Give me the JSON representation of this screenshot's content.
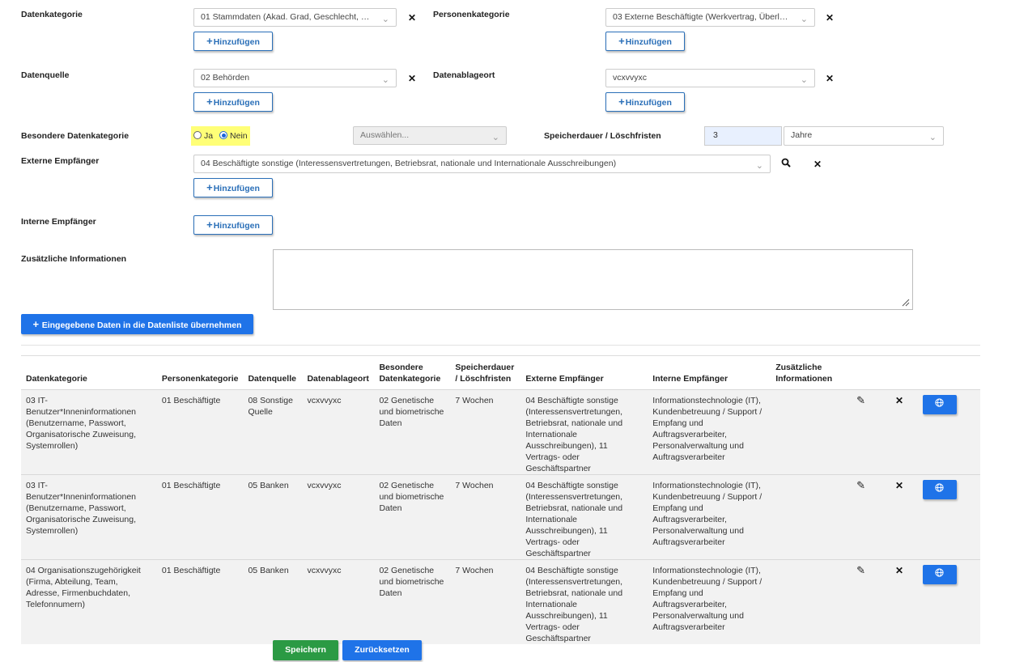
{
  "form": {
    "datenkategorie": {
      "label": "Datenkategorie",
      "value": "01 Stammdaten (Akad. Grad, Geschlecht, Vor..."
    },
    "personenkategorie": {
      "label": "Personenkategorie",
      "value": "03 Externe Beschäftigte (Werkvertrag, Überlass..."
    },
    "datenquelle": {
      "label": "Datenquelle",
      "value": "02 Behörden"
    },
    "datenablageort": {
      "label": "Datenablageort",
      "value": "vcxvvyxc"
    },
    "besondere": {
      "label": "Besondere Datenkategorie",
      "ja": "Ja",
      "nein": "Nein",
      "select_placeholder": "Auswählen..."
    },
    "speicherdauer": {
      "label": "Speicherdauer / Löschfristen",
      "value": "3",
      "unit": "Jahre"
    },
    "externe": {
      "label": "Externe Empfänger",
      "value": "04 Beschäftigte sonstige (Interessensvertretungen, Betriebsrat, nationale und Internationale Ausschreibungen)"
    },
    "interne": {
      "label": "Interne Empfänger"
    },
    "zusatz": {
      "label": "Zusätzliche Informationen"
    },
    "add_label": "Hinzufügen",
    "remove_glyph": "✕",
    "submit_label": "Eingegebene Daten in die Datenliste übernehmen"
  },
  "table": {
    "headers": {
      "c1": "Datenkategorie",
      "c2": "Personenkategorie",
      "c3": "Datenquelle",
      "c4": "Datenablageort",
      "c5": "Besondere Datenkategorie",
      "c6": "Speicherdauer / Löschfristen",
      "c7": "Externe Empfänger",
      "c8": "Interne Empfänger",
      "c9": "Zusätzliche Informationen"
    },
    "rows": [
      {
        "datenkategorie": "03 IT-Benutzer*Inneninformationen (Benutzername, Passwort, Organisatorische Zuweisung, Systemrollen)",
        "personenkategorie": "01 Beschäftigte",
        "datenquelle": "08 Sonstige Quelle",
        "datenablageort": "vcxvvyxc",
        "besondere": "02 Genetische und biometrische Daten",
        "speicherdauer": "7 Wochen",
        "externe": "04 Beschäftigte sonstige (Interessensvertretungen, Betriebsrat, nationale und Internationale Ausschreibungen), 11 Vertrags- oder Geschäftspartner",
        "interne": "Informationstechnologie (IT), Kundenbetreuung / Support / Empfang und Auftragsverarbeiter, Personalverwaltung und Auftragsverarbeiter",
        "zusatz": ""
      },
      {
        "datenkategorie": "03 IT-Benutzer*Inneninformationen (Benutzername, Passwort, Organisatorische Zuweisung, Systemrollen)",
        "personenkategorie": "01 Beschäftigte",
        "datenquelle": "05 Banken",
        "datenablageort": "vcxvvyxc",
        "besondere": "02 Genetische und biometrische Daten",
        "speicherdauer": "7 Wochen",
        "externe": "04 Beschäftigte sonstige (Interessensvertretungen, Betriebsrat, nationale und Internationale Ausschreibungen), 11 Vertrags- oder Geschäftspartner",
        "interne": "Informationstechnologie (IT), Kundenbetreuung / Support / Empfang und Auftragsverarbeiter, Personalverwaltung und Auftragsverarbeiter",
        "zusatz": ""
      },
      {
        "datenkategorie": "04 Organisationszugehörigkeit (Firma, Abteilung, Team, Adresse, Firmenbuchdaten, Telefonnumern)",
        "personenkategorie": "01 Beschäftigte",
        "datenquelle": "05 Banken",
        "datenablageort": "vcxvvyxc",
        "besondere": "02 Genetische und biometrische Daten",
        "speicherdauer": "7 Wochen",
        "externe": "04 Beschäftigte sonstige (Interessensvertretungen, Betriebsrat, nationale und Internationale Ausschreibungen), 11 Vertrags- oder Geschäftspartner",
        "interne": "Informationstechnologie (IT), Kundenbetreuung / Support / Empfang und Auftragsverarbeiter, Personalverwaltung und Auftragsverarbeiter",
        "zusatz": ""
      }
    ]
  },
  "footer": {
    "save_label": "Speichern",
    "reset_label": "Zurücksetzen"
  },
  "colors": {
    "primary": "#1f73e8",
    "success": "#2b9a44",
    "highlight": "#ffff77"
  },
  "icons": {
    "edit": "pencil-icon",
    "delete": "close-icon",
    "globe": "globe-icon",
    "search": "search-icon",
    "chevron": "chevron-down-icon",
    "plus": "plus-icon"
  }
}
